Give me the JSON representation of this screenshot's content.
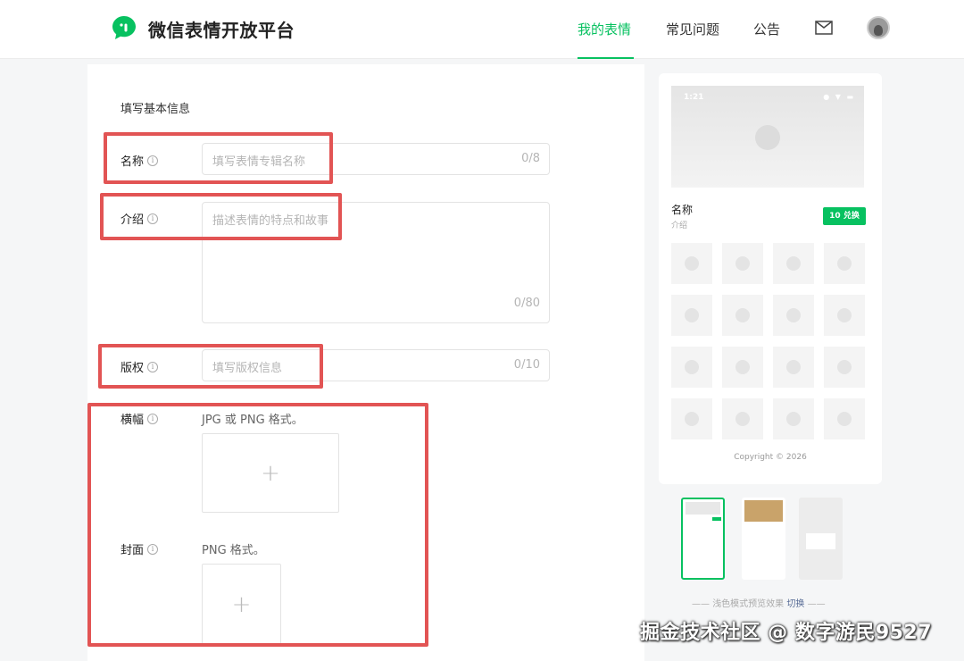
{
  "header": {
    "brand": "微信表情开放平台",
    "nav": [
      "我的表情",
      "常见问题",
      "公告"
    ],
    "active_nav": "我的表情"
  },
  "form": {
    "section_title": "填写基本信息",
    "name": {
      "label": "名称",
      "placeholder": "填写表情专辑名称",
      "counter": "0/8"
    },
    "intro": {
      "label": "介绍",
      "placeholder": "描述表情的特点和故事",
      "counter": "0/80"
    },
    "copyright": {
      "label": "版权",
      "placeholder": "填写版权信息",
      "counter": "0/10"
    },
    "banner": {
      "label": "横幅",
      "hint": "JPG 或 PNG 格式。"
    },
    "cover": {
      "label": "封面",
      "hint": "PNG 格式。"
    }
  },
  "preview": {
    "time": "1:21",
    "name": "名称",
    "desc": "介绍",
    "badge": "10 兑换",
    "copyright": "Copyright © 2026",
    "mode_text": "浅色模式预览效果",
    "switch_label": "切换"
  },
  "watermark": "掘金技术社区 @ 数字游民9527",
  "colors": {
    "accent": "#07c160",
    "highlight": "#e25454",
    "link": "#576b95"
  }
}
